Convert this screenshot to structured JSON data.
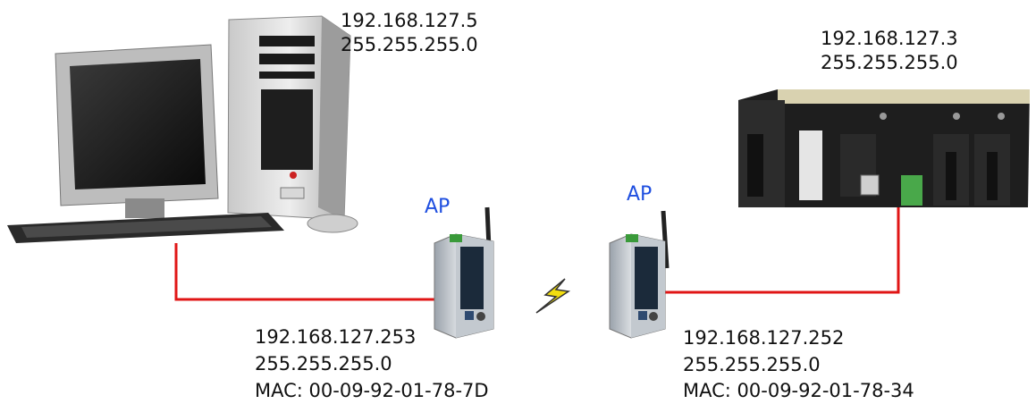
{
  "pc": {
    "ip": "192.168.127.5",
    "mask": "255.255.255.0"
  },
  "plc": {
    "ip": "192.168.127.3",
    "mask": "255.255.255.0"
  },
  "ap_left": {
    "label": "AP",
    "ip": "192.168.127.253",
    "mask": "255.255.255.0",
    "mac": "MAC: 00-09-92-01-78-7D"
  },
  "ap_right": {
    "label": "AP",
    "ip": "192.168.127.252",
    "mask": "255.255.255.0",
    "mac": "MAC: 00-09-92-01-78-34"
  },
  "colors": {
    "cable": "#e01515",
    "ap_label": "#1f4fe0",
    "wireless_bolt": "#f2dd10"
  },
  "icons": [
    "desktop-computer-icon",
    "access-point-icon",
    "plc-rack-icon",
    "lightning-bolt-icon"
  ]
}
